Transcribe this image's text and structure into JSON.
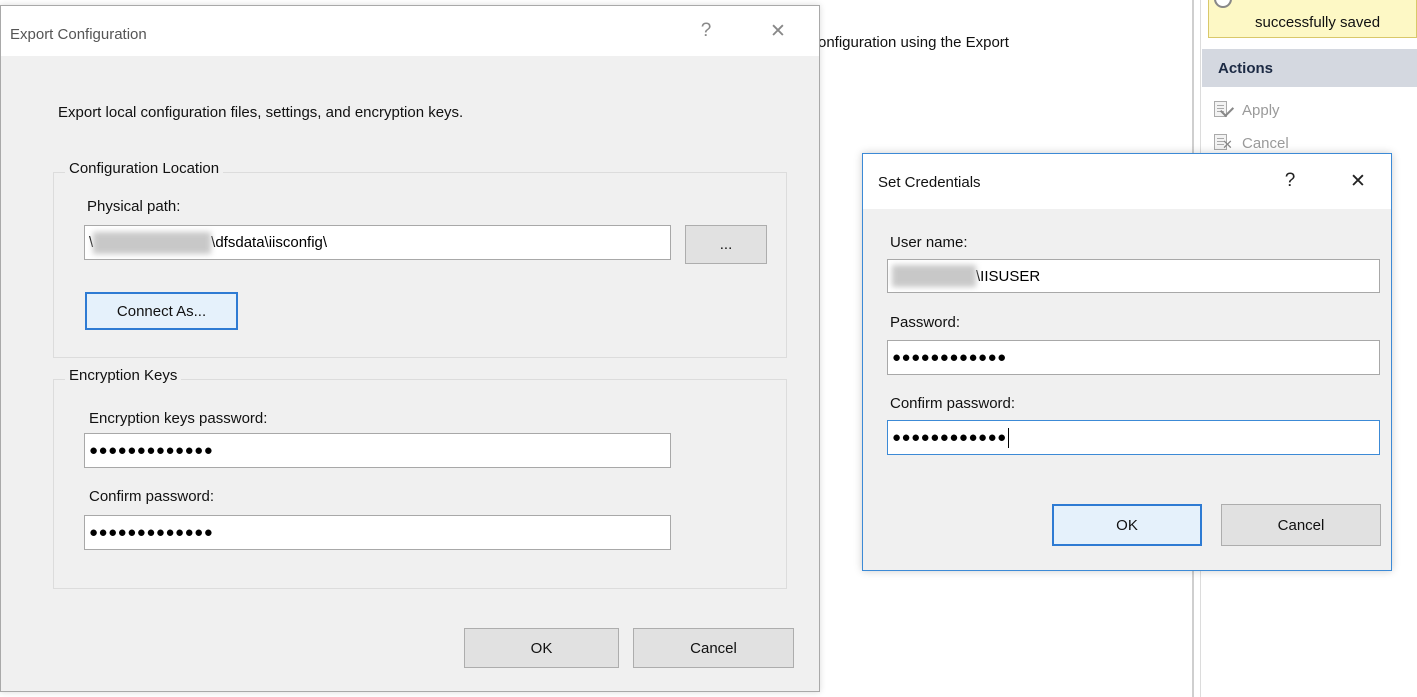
{
  "background": {
    "description_text": "onfiguration using the Export",
    "alert_text": "successfully saved",
    "actions": {
      "header": "Actions",
      "items": [
        {
          "label": "Apply",
          "icon": "apply-icon"
        },
        {
          "label": "Cancel",
          "icon": "cancel-icon"
        }
      ]
    }
  },
  "export_dialog": {
    "title": "Export Configuration",
    "help": "?",
    "close": "✕",
    "intro": "Export local configuration files, settings, and encryption keys.",
    "config_location": {
      "legend": "Configuration Location",
      "physical_path_label": "Physical path:",
      "physical_path_prefix": "\\",
      "physical_path_suffix": "\\dfsdata\\iisconfig\\",
      "browse_label": "...",
      "connect_as_label": "Connect As..."
    },
    "encryption_keys": {
      "legend": "Encryption Keys",
      "password_label": "Encryption keys password:",
      "password_value": "●●●●●●●●●●●●●",
      "confirm_label": "Confirm password:",
      "confirm_value": "●●●●●●●●●●●●●"
    },
    "ok_label": "OK",
    "cancel_label": "Cancel"
  },
  "credentials_dialog": {
    "title": "Set Credentials",
    "help": "?",
    "close": "✕",
    "username_label": "User name:",
    "username_suffix": "\\IISUSER",
    "password_label": "Password:",
    "password_value": "●●●●●●●●●●●●",
    "confirm_label": "Confirm password:",
    "confirm_value": "●●●●●●●●●●●●",
    "ok_label": "OK",
    "cancel_label": "Cancel"
  },
  "colors": {
    "dialog_bg": "#f0f0f0",
    "accent": "#3c8ad6",
    "actions_header_bg": "#d4d8e0",
    "alert_bg": "#fdf8c5"
  }
}
